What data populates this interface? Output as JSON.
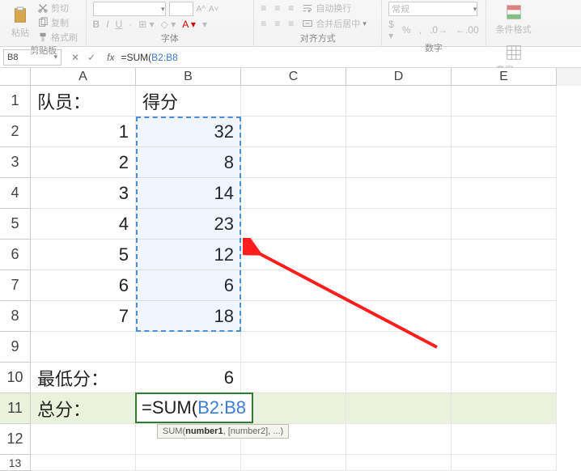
{
  "ribbon": {
    "groups": {
      "clipboard": {
        "title": "剪贴板",
        "paste": "粘贴",
        "cut": "剪切",
        "copy": "复制",
        "format_painter": "格式刷"
      },
      "font": {
        "title": "字体",
        "bold": "B",
        "italic": "I",
        "underline": "U",
        "size_up": "A",
        "size_down": "A"
      },
      "align": {
        "title": "对齐方式",
        "wrap": "自动换行",
        "merge": "合并后居中"
      },
      "number": {
        "title": "数字",
        "general": "常规",
        "percent": "%",
        "comma": ",",
        "inc": ".0",
        "dec": ".00"
      },
      "styles": {
        "cond": "条件格式",
        "table": "套用\n表格格式"
      }
    }
  },
  "formula_bar": {
    "name_box": "B8",
    "cancel": "✕",
    "confirm": "✓",
    "fx": "fx",
    "value_prefix": "=SUM(",
    "value_ref": "B2:B8"
  },
  "columns": [
    "A",
    "B",
    "C",
    "D",
    "E"
  ],
  "rows": [
    1,
    2,
    3,
    4,
    5,
    6,
    7,
    8,
    9,
    10,
    11,
    12,
    13
  ],
  "cells": {
    "A1": "队员：",
    "B1": "得分",
    "A2": "1",
    "B2": "32",
    "A3": "2",
    "B3": "8",
    "A4": "3",
    "B4": "14",
    "A5": "4",
    "B5": "23",
    "A6": "5",
    "B6": "12",
    "A7": "6",
    "B7": "6",
    "A8": "7",
    "B8": "18",
    "A10": "最低分：",
    "B10": "6",
    "A11": "总分："
  },
  "editing": {
    "prefix": "=SUM(",
    "ref": "B2:B8"
  },
  "tooltip": {
    "text": "SUM(number1, [number2], ...)",
    "bold": "number1"
  },
  "chart_data": {
    "type": "table",
    "title": "得分",
    "categories": [
      "1",
      "2",
      "3",
      "4",
      "5",
      "6",
      "7"
    ],
    "values": [
      32,
      8,
      14,
      23,
      12,
      6,
      18
    ],
    "summary": {
      "最低分": 6,
      "总分公式": "=SUM(B2:B8)"
    }
  }
}
